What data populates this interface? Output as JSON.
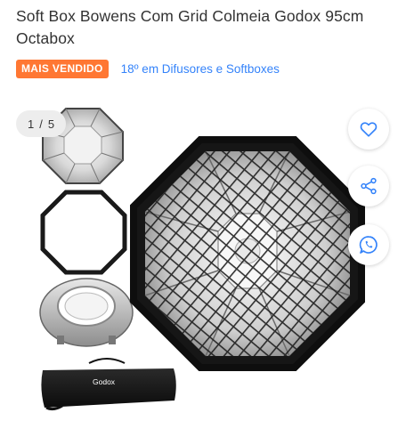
{
  "product": {
    "title": "Soft Box Bowens Com Grid Colmeia Godox 95cm Octabox"
  },
  "badges": {
    "best_seller": "MAIS VENDIDO",
    "ranking": "18º em Difusores e Softboxes"
  },
  "gallery": {
    "current": "1",
    "separator": "/",
    "total": "5",
    "bag_brand": "Godox"
  },
  "actions": {
    "favorite_icon": "heart-icon",
    "share_icon": "share-icon",
    "whatsapp_icon": "whatsapp-icon"
  },
  "colors": {
    "badge_bg": "#ff7733",
    "link": "#3483fa",
    "icon_blue": "#3483fa"
  }
}
